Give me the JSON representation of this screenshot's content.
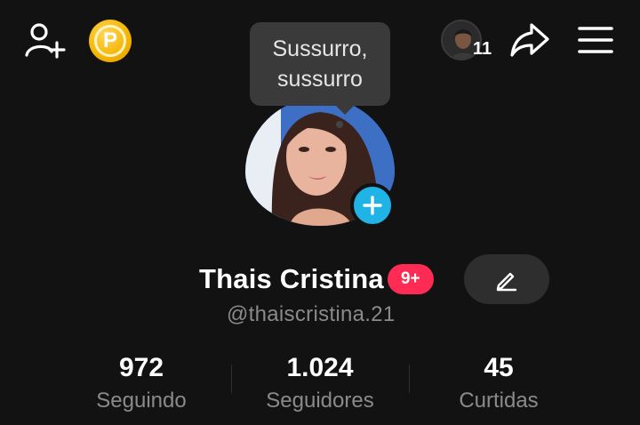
{
  "header": {
    "add_friend_icon": "person-plus-icon",
    "coin_icon": "coin-icon",
    "coin_letter": "P",
    "visitor_count": "11",
    "share_icon": "share-arrow-icon",
    "menu_icon": "hamburger-menu-icon"
  },
  "tooltip": {
    "line1": "Sussurro,",
    "line2": "sussurro"
  },
  "profile": {
    "name": "Thais Cristina",
    "notification_badge": "9+",
    "username": "@thaiscristina.21",
    "add_story_icon": "plus-icon",
    "edit_icon": "pencil-icon"
  },
  "stats": [
    {
      "value": "972",
      "label": "Seguindo"
    },
    {
      "value": "1.024",
      "label": "Seguidores"
    },
    {
      "value": "45",
      "label": "Curtidas"
    }
  ],
  "colors": {
    "background": "#121212",
    "badge": "#fe2c55",
    "add_story": "#20b3e6",
    "coin": "#f4b400",
    "secondary_text": "#8a8a8a"
  }
}
